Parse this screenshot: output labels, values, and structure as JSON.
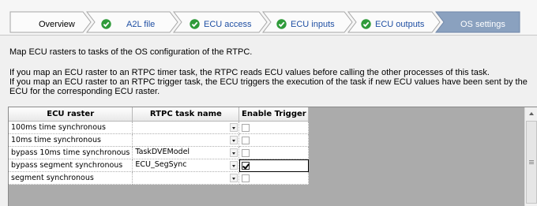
{
  "wizard": {
    "steps": [
      {
        "label": "Overview",
        "state": "plain"
      },
      {
        "label": "A2L file",
        "state": "done"
      },
      {
        "label": "ECU access",
        "state": "done"
      },
      {
        "label": "ECU inputs",
        "state": "done"
      },
      {
        "label": "ECU outputs",
        "state": "done"
      },
      {
        "label": "OS settings",
        "state": "active"
      }
    ],
    "colors": {
      "active_fill": "#8aa1bf",
      "done_check": "#2f9b3a"
    }
  },
  "description": {
    "line1": "Map ECU rasters to tasks of the OS configuration of the RTPC.",
    "line2": "If you map an ECU raster to an RTPC timer task, the RTPC reads ECU values before calling the other processes of this task.",
    "line3": "If you map an ECU raster to an RTPC trigger task, the ECU triggers the execution of the task if new ECU values have been sent by the ECU for the corresponding ECU raster."
  },
  "grid": {
    "columns": [
      "ECU raster",
      "RTPC task name",
      "Enable Trigger"
    ],
    "rows": [
      {
        "raster": "100ms time synchronous",
        "task": "",
        "trigger": false
      },
      {
        "raster": "10ms time synchronous",
        "task": "",
        "trigger": false
      },
      {
        "raster": "bypass 10ms time synchronous",
        "task": "TaskDVEModel",
        "trigger": false
      },
      {
        "raster": "bypass segment synchronous",
        "task": "ECU_SegSync",
        "trigger": true
      },
      {
        "raster": "segment synchronous",
        "task": "",
        "trigger": false
      }
    ]
  }
}
